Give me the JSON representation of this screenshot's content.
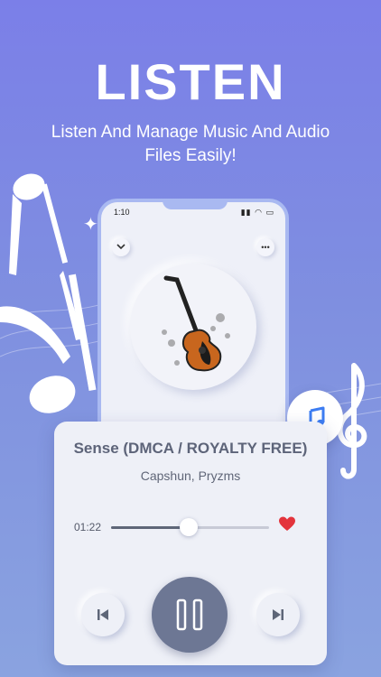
{
  "hero": {
    "title": "LISTEN",
    "subtitle": "Listen And Manage Music And Audio Files Easily!"
  },
  "phone": {
    "status_time": "1:10",
    "status_icons": [
      "signal-icon",
      "wifi-icon",
      "battery-icon"
    ],
    "collapse_icon": "chevron-down-icon",
    "more_icon": "more-icon",
    "artwork": "guitar-artwork"
  },
  "player": {
    "track_title": "Sense (DMCA / ROYALTY FREE)",
    "artist": "Capshun, Pryzms",
    "elapsed": "01:22",
    "progress": 0.49,
    "favorite": true,
    "controls": [
      "previous-icon",
      "pause-icon",
      "next-icon"
    ]
  },
  "colors": {
    "accent_blue": "#3d7df2",
    "heart_red": "#e3343c",
    "play_button": "#6d7794"
  }
}
